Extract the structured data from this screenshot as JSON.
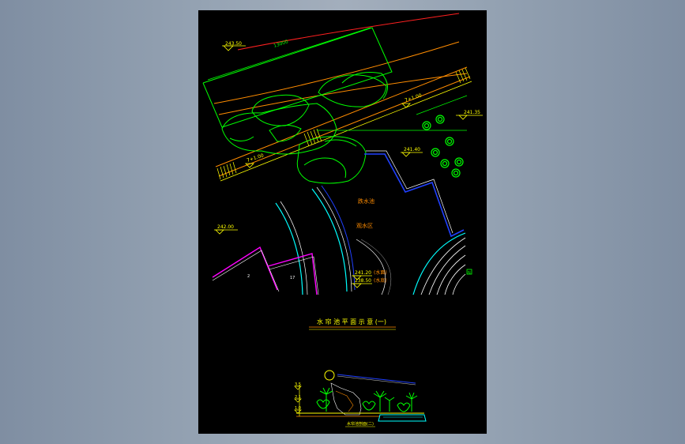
{
  "drawing": {
    "plan": {
      "elev_top": "243.50",
      "dim_top": "13000",
      "elev_right_top": "241.35",
      "elev_mid_right": "241.40",
      "elev_left": "242.00",
      "slope_a": "7+1.00",
      "slope_b": "7+1.00",
      "label_pool": "跌水池",
      "label_viewing": "观水区",
      "elev_water1": "241.20",
      "water1_note": "(水面)",
      "elev_water2": "238.50",
      "water2_note": "(水底)",
      "zone_2": "2",
      "zone_17": "17",
      "north_mark": "N"
    },
    "title": "水 帘 池 平 面 示 意 (一)",
    "section": {
      "elev_a": "3.5",
      "elev_b": "2.1",
      "elev_c": "1.0",
      "caption": "水帘池剖面(二)"
    }
  },
  "colors": {
    "background": "#000000",
    "green": "#00ff00",
    "yellow": "#ffff00",
    "orange": "#ff8c00",
    "red": "#ff2020",
    "cyan": "#00ffff",
    "magenta": "#ff00ff",
    "blue": "#2040ff",
    "white": "#ffffff"
  }
}
